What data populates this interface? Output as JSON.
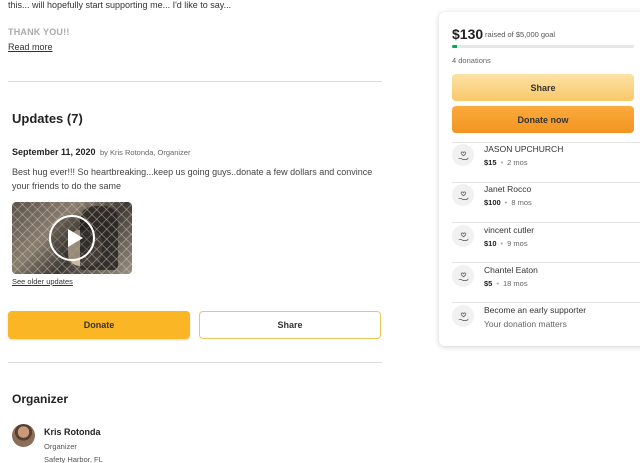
{
  "story": {
    "text": "this... will hopefully start supporting me... I'd like to say...",
    "thanks": "THANK YOU!!",
    "read_more": "Read more"
  },
  "updates": {
    "title": "Updates (7)",
    "date": "September 11, 2020",
    "author": "by Kris Rotonda, Organizer",
    "body": "Best hug ever!!! So heartbreaking...keep us going guys..donate a few dollars and convince your friends to do the same",
    "older_link": "See older updates"
  },
  "actions": {
    "donate_label": "Donate",
    "share_label": "Share"
  },
  "organizer": {
    "title": "Organizer",
    "name": "Kris Rotonda",
    "role": "Organizer",
    "location": "Safety Harbor, FL"
  },
  "sidebar": {
    "amount": "$130",
    "goal_text": "raised of $5,000 goal",
    "progress_fraction": 0.026,
    "donations_count": "4 donations",
    "share_label": "Share",
    "donate_label": "Donate now",
    "donors": [
      {
        "name": "JASON UPCHURCH",
        "amount": "$15",
        "time": "2 mos"
      },
      {
        "name": "Janet Rocco",
        "amount": "$100",
        "time": "8 mos"
      },
      {
        "name": "vincent cutler",
        "amount": "$10",
        "time": "9 mos"
      },
      {
        "name": "Chantel Eaton",
        "amount": "$5",
        "time": "18 mos"
      }
    ],
    "early": {
      "title": "Become an early supporter",
      "subtitle": "Your donation matters"
    }
  },
  "colors": {
    "accent": "#fbb625",
    "progress": "#02a95c",
    "donate_gradient_end": "#f29421"
  },
  "icons": {
    "donor": "donor-heart-hand-icon",
    "play": "play-icon"
  }
}
